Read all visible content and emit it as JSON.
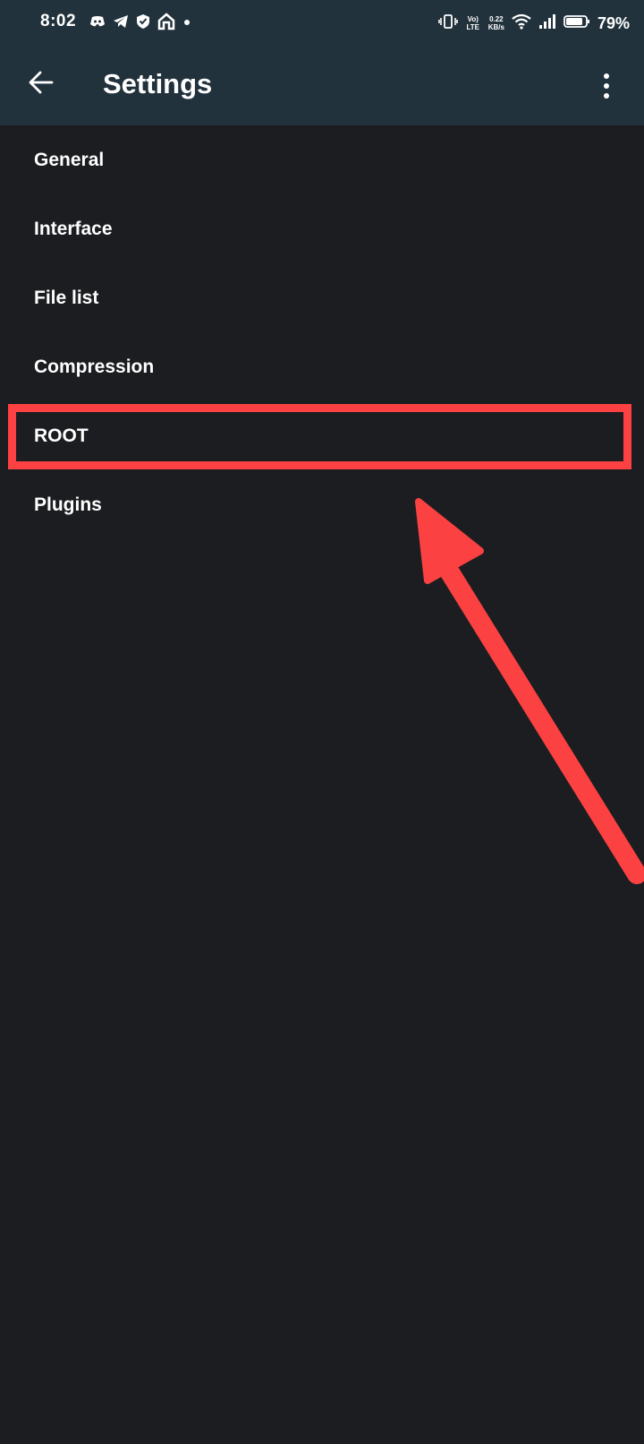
{
  "status_bar": {
    "time": "8:02",
    "network": "Vo) LTE",
    "speed_value": "0.22",
    "speed_unit": "KB/s",
    "battery": "79%"
  },
  "app_bar": {
    "title": "Settings"
  },
  "settings_items": [
    {
      "label": "General"
    },
    {
      "label": "Interface"
    },
    {
      "label": "File list"
    },
    {
      "label": "Compression"
    },
    {
      "label": "ROOT"
    },
    {
      "label": "Plugins"
    }
  ],
  "colors": {
    "toolbar": "#22323d",
    "background": "#1b1d20",
    "annotation": "#fb4141"
  },
  "icons": {
    "status_left": [
      "discord-icon",
      "telegram-icon",
      "shield-icon",
      "home-icon",
      "dot-icon"
    ],
    "status_right": [
      "vibrate-icon",
      "wifi-icon",
      "signal-icon",
      "battery-icon"
    ],
    "app_bar": [
      "back-arrow-icon",
      "more-vert-icon"
    ]
  },
  "annotation": {
    "highlighted_item": "ROOT",
    "arrow_points_to": "ROOT"
  }
}
